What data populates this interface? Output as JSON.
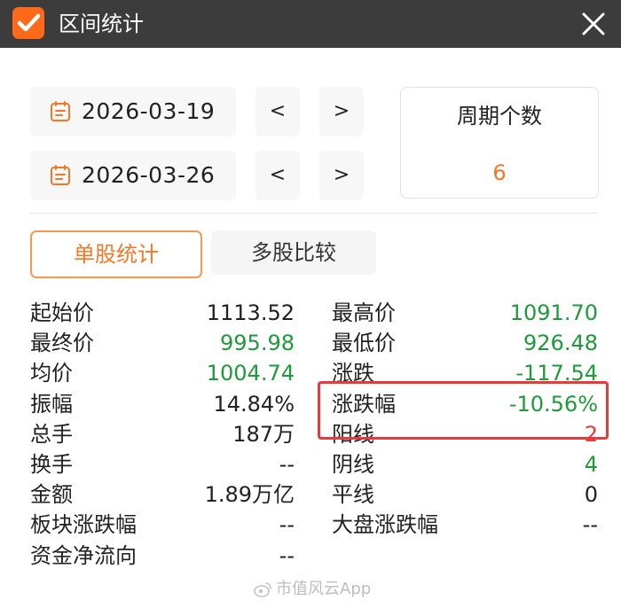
{
  "window": {
    "title": "区间统计"
  },
  "dates": {
    "start": "2026-03-19",
    "end": "2026-03-26",
    "prev_label": "<",
    "next_label": ">"
  },
  "period": {
    "label": "周期个数",
    "value": "6"
  },
  "tabs": [
    {
      "label": "单股统计",
      "active": true
    },
    {
      "label": "多股比较",
      "active": false
    }
  ],
  "stats": {
    "left": [
      {
        "label": "起始价",
        "value": "1113.52",
        "color": "#222222"
      },
      {
        "label": "最终价",
        "value": "995.98",
        "color": "#1e9a3a"
      },
      {
        "label": "均价",
        "value": "1004.74",
        "color": "#1e9a3a"
      },
      {
        "label": "振幅",
        "value": "14.84%",
        "color": "#222222"
      },
      {
        "label": "总手",
        "value": "187万",
        "color": "#222222"
      },
      {
        "label": "换手",
        "value": "--",
        "color": "#222222"
      },
      {
        "label": "金额",
        "value": "1.89万亿",
        "color": "#222222"
      },
      {
        "label": "板块涨跌幅",
        "value": "--",
        "color": "#222222"
      },
      {
        "label": "资金净流向",
        "value": "--",
        "color": "#222222"
      }
    ],
    "right": [
      {
        "label": "最高价",
        "value": "1091.70",
        "color": "#1e9a3a"
      },
      {
        "label": "最低价",
        "value": "926.48",
        "color": "#1e9a3a"
      },
      {
        "label": "涨跌",
        "value": "-117.54",
        "color": "#1e9a3a"
      },
      {
        "label": "涨跌幅",
        "value": "-10.56%",
        "color": "#1e9a3a"
      },
      {
        "label": "阳线",
        "value": "2",
        "color": "#e83a3a"
      },
      {
        "label": "阴线",
        "value": "4",
        "color": "#1e9a3a"
      },
      {
        "label": "平线",
        "value": "0",
        "color": "#222222"
      },
      {
        "label": "大盘涨跌幅",
        "value": "--",
        "color": "#222222"
      }
    ]
  },
  "watermark": {
    "text": "市值风云App"
  },
  "icons": {
    "logo": "checkmark-logo-icon",
    "close": "close-icon",
    "calendar": "calendar-icon"
  },
  "colors": {
    "accent": "#f07828",
    "up": "#e83a3a",
    "down": "#1e9a3a",
    "titlebar": "#3c3c3c"
  }
}
